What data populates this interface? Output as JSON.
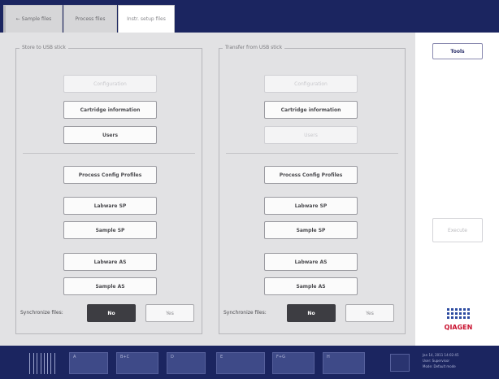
{
  "tabs": [
    {
      "label": "← Sample files"
    },
    {
      "label": "Process files"
    },
    {
      "label": "Instr. setup files"
    }
  ],
  "left_panel": {
    "title": "Store to USB stick",
    "buttons": {
      "configuration": "Configuration",
      "cartridge_info": "Cartridge information",
      "users": "Users",
      "process_config": "Process Config Profiles",
      "lab_sp": "Labware SP",
      "sample_sp": "Sample SP",
      "lab_as": "Labware AS",
      "sample_as": "Sample AS"
    },
    "sync_label": "Synchronize files:",
    "sync_yes": "No",
    "sync_no": "Yes"
  },
  "right_panel": {
    "title": "Transfer from USB stick",
    "buttons": {
      "configuration": "Configuration",
      "cartridge_info": "Cartridge information",
      "users": "Users",
      "process_config": "Process Config Profiles",
      "lab_sp": "Labware SP",
      "sample_sp": "Sample SP",
      "lab_as": "Labware AS",
      "sample_as": "Sample AS"
    },
    "sync_label": "Synchronize files:",
    "sync_yes": "No",
    "sync_no": "Yes"
  },
  "sidebar": {
    "tools": "Tools",
    "second": "Execute",
    "logo_text": "QIAGEN"
  },
  "bottom": {
    "slots": [
      "A",
      "B+C",
      "D",
      "E",
      "F+G",
      "H"
    ],
    "status_lines": [
      "Jan 14, 2011 14:02:45",
      "User:    Supervisor",
      "Mode:    Default mode"
    ]
  },
  "colors": {
    "navy": "#1b2560",
    "selected": "#3d3d42",
    "logo_blue": "#2b4aa0",
    "logo_red": "#c8102e"
  }
}
